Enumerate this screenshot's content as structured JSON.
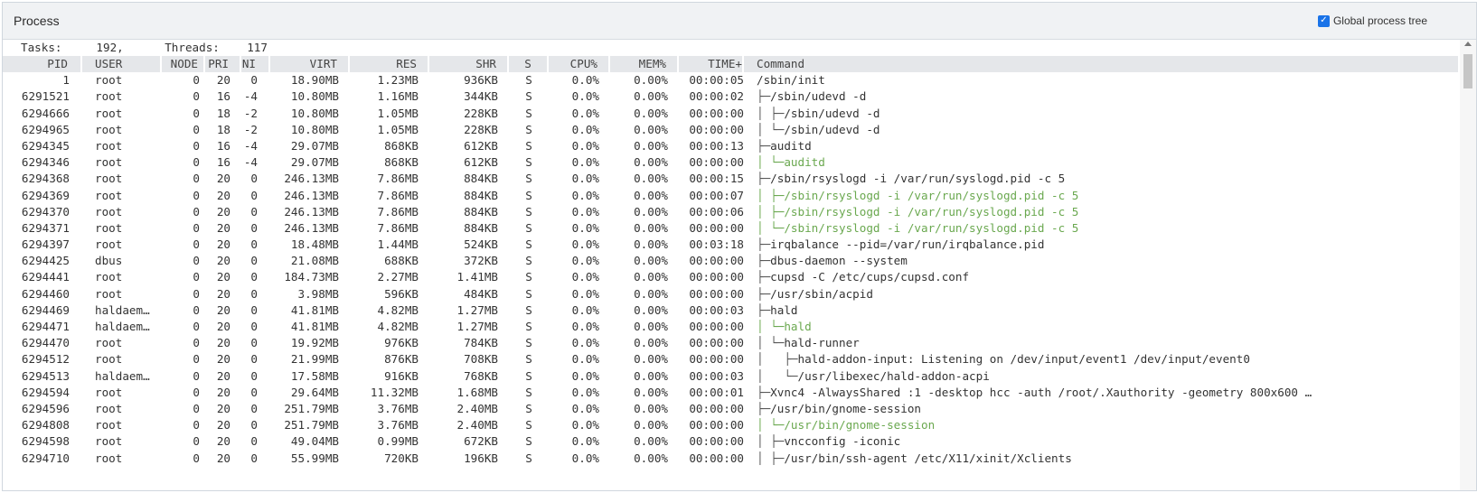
{
  "panel": {
    "title": "Process",
    "tree_toggle_label": "Global process tree",
    "tree_toggle_checked": true
  },
  "stats": {
    "text": "Tasks:     192,      Threads:    117"
  },
  "columns": [
    "PID",
    "USER",
    "NODE",
    "PRI",
    "NI",
    "VIRT",
    "RES",
    "SHR",
    "S",
    "CPU%",
    "MEM%",
    "TIME+",
    "Command"
  ],
  "rows": [
    {
      "pid": "1",
      "user": "root",
      "node": "0",
      "pri": "20",
      "ni": "0",
      "virt": "18.90MB",
      "res": "1.23MB",
      "shr": "936KB",
      "s": "S",
      "cpu": "0.0%",
      "mem": "0.00%",
      "time": "00:00:05",
      "tree": "",
      "cmd": "/sbin/init",
      "thread": false
    },
    {
      "pid": "6291521",
      "user": "root",
      "node": "0",
      "pri": "16",
      "ni": "-4",
      "virt": "10.80MB",
      "res": "1.16MB",
      "shr": "344KB",
      "s": "S",
      "cpu": "0.0%",
      "mem": "0.00%",
      "time": "00:00:02",
      "tree": "├─",
      "cmd": "/sbin/udevd -d",
      "thread": false
    },
    {
      "pid": "6294666",
      "user": "root",
      "node": "0",
      "pri": "18",
      "ni": "-2",
      "virt": "10.80MB",
      "res": "1.05MB",
      "shr": "228KB",
      "s": "S",
      "cpu": "0.0%",
      "mem": "0.00%",
      "time": "00:00:00",
      "tree": "│ ├─",
      "cmd": "/sbin/udevd -d",
      "thread": false
    },
    {
      "pid": "6294965",
      "user": "root",
      "node": "0",
      "pri": "18",
      "ni": "-2",
      "virt": "10.80MB",
      "res": "1.05MB",
      "shr": "228KB",
      "s": "S",
      "cpu": "0.0%",
      "mem": "0.00%",
      "time": "00:00:00",
      "tree": "│ └─",
      "cmd": "/sbin/udevd -d",
      "thread": false
    },
    {
      "pid": "6294345",
      "user": "root",
      "node": "0",
      "pri": "16",
      "ni": "-4",
      "virt": "29.07MB",
      "res": "868KB",
      "shr": "612KB",
      "s": "S",
      "cpu": "0.0%",
      "mem": "0.00%",
      "time": "00:00:13",
      "tree": "├─",
      "cmd": "auditd",
      "thread": false
    },
    {
      "pid": "6294346",
      "user": "root",
      "node": "0",
      "pri": "16",
      "ni": "-4",
      "virt": "29.07MB",
      "res": "868KB",
      "shr": "612KB",
      "s": "S",
      "cpu": "0.0%",
      "mem": "0.00%",
      "time": "00:00:00",
      "tree": "│ └─",
      "cmd": "auditd",
      "thread": true
    },
    {
      "pid": "6294368",
      "user": "root",
      "node": "0",
      "pri": "20",
      "ni": "0",
      "virt": "246.13MB",
      "res": "7.86MB",
      "shr": "884KB",
      "s": "S",
      "cpu": "0.0%",
      "mem": "0.00%",
      "time": "00:00:15",
      "tree": "├─",
      "cmd": "/sbin/rsyslogd -i /var/run/syslogd.pid -c 5",
      "thread": false
    },
    {
      "pid": "6294369",
      "user": "root",
      "node": "0",
      "pri": "20",
      "ni": "0",
      "virt": "246.13MB",
      "res": "7.86MB",
      "shr": "884KB",
      "s": "S",
      "cpu": "0.0%",
      "mem": "0.00%",
      "time": "00:00:07",
      "tree": "│ ├─",
      "cmd": "/sbin/rsyslogd -i /var/run/syslogd.pid -c 5",
      "thread": true
    },
    {
      "pid": "6294370",
      "user": "root",
      "node": "0",
      "pri": "20",
      "ni": "0",
      "virt": "246.13MB",
      "res": "7.86MB",
      "shr": "884KB",
      "s": "S",
      "cpu": "0.0%",
      "mem": "0.00%",
      "time": "00:00:06",
      "tree": "│ ├─",
      "cmd": "/sbin/rsyslogd -i /var/run/syslogd.pid -c 5",
      "thread": true
    },
    {
      "pid": "6294371",
      "user": "root",
      "node": "0",
      "pri": "20",
      "ni": "0",
      "virt": "246.13MB",
      "res": "7.86MB",
      "shr": "884KB",
      "s": "S",
      "cpu": "0.0%",
      "mem": "0.00%",
      "time": "00:00:00",
      "tree": "│ └─",
      "cmd": "/sbin/rsyslogd -i /var/run/syslogd.pid -c 5",
      "thread": true
    },
    {
      "pid": "6294397",
      "user": "root",
      "node": "0",
      "pri": "20",
      "ni": "0",
      "virt": "18.48MB",
      "res": "1.44MB",
      "shr": "524KB",
      "s": "S",
      "cpu": "0.0%",
      "mem": "0.00%",
      "time": "00:03:18",
      "tree": "├─",
      "cmd": "irqbalance --pid=/var/run/irqbalance.pid",
      "thread": false
    },
    {
      "pid": "6294425",
      "user": "dbus",
      "node": "0",
      "pri": "20",
      "ni": "0",
      "virt": "21.08MB",
      "res": "688KB",
      "shr": "372KB",
      "s": "S",
      "cpu": "0.0%",
      "mem": "0.00%",
      "time": "00:00:00",
      "tree": "├─",
      "cmd": "dbus-daemon --system",
      "thread": false
    },
    {
      "pid": "6294441",
      "user": "root",
      "node": "0",
      "pri": "20",
      "ni": "0",
      "virt": "184.73MB",
      "res": "2.27MB",
      "shr": "1.41MB",
      "s": "S",
      "cpu": "0.0%",
      "mem": "0.00%",
      "time": "00:00:00",
      "tree": "├─",
      "cmd": "cupsd -C /etc/cups/cupsd.conf",
      "thread": false
    },
    {
      "pid": "6294460",
      "user": "root",
      "node": "0",
      "pri": "20",
      "ni": "0",
      "virt": "3.98MB",
      "res": "596KB",
      "shr": "484KB",
      "s": "S",
      "cpu": "0.0%",
      "mem": "0.00%",
      "time": "00:00:00",
      "tree": "├─",
      "cmd": "/usr/sbin/acpid",
      "thread": false
    },
    {
      "pid": "6294469",
      "user": "haldaem…",
      "node": "0",
      "pri": "20",
      "ni": "0",
      "virt": "41.81MB",
      "res": "4.82MB",
      "shr": "1.27MB",
      "s": "S",
      "cpu": "0.0%",
      "mem": "0.00%",
      "time": "00:00:03",
      "tree": "├─",
      "cmd": "hald",
      "thread": false
    },
    {
      "pid": "6294471",
      "user": "haldaem…",
      "node": "0",
      "pri": "20",
      "ni": "0",
      "virt": "41.81MB",
      "res": "4.82MB",
      "shr": "1.27MB",
      "s": "S",
      "cpu": "0.0%",
      "mem": "0.00%",
      "time": "00:00:00",
      "tree": "│ └─",
      "cmd": "hald",
      "thread": true
    },
    {
      "pid": "6294470",
      "user": "root",
      "node": "0",
      "pri": "20",
      "ni": "0",
      "virt": "19.92MB",
      "res": "976KB",
      "shr": "784KB",
      "s": "S",
      "cpu": "0.0%",
      "mem": "0.00%",
      "time": "00:00:00",
      "tree": "│ └─",
      "cmd": "hald-runner",
      "thread": false
    },
    {
      "pid": "6294512",
      "user": "root",
      "node": "0",
      "pri": "20",
      "ni": "0",
      "virt": "21.99MB",
      "res": "876KB",
      "shr": "708KB",
      "s": "S",
      "cpu": "0.0%",
      "mem": "0.00%",
      "time": "00:00:00",
      "tree": "│   ├─",
      "cmd": "hald-addon-input: Listening on /dev/input/event1 /dev/input/event0",
      "thread": false
    },
    {
      "pid": "6294513",
      "user": "haldaem…",
      "node": "0",
      "pri": "20",
      "ni": "0",
      "virt": "17.58MB",
      "res": "916KB",
      "shr": "768KB",
      "s": "S",
      "cpu": "0.0%",
      "mem": "0.00%",
      "time": "00:00:03",
      "tree": "│   └─",
      "cmd": "/usr/libexec/hald-addon-acpi",
      "thread": false
    },
    {
      "pid": "6294594",
      "user": "root",
      "node": "0",
      "pri": "20",
      "ni": "0",
      "virt": "29.64MB",
      "res": "11.32MB",
      "shr": "1.68MB",
      "s": "S",
      "cpu": "0.0%",
      "mem": "0.00%",
      "time": "00:00:01",
      "tree": "├─",
      "cmd": "Xvnc4 -AlwaysShared :1 -desktop hcc -auth /root/.Xauthority -geometry 800x600 …",
      "thread": false
    },
    {
      "pid": "6294596",
      "user": "root",
      "node": "0",
      "pri": "20",
      "ni": "0",
      "virt": "251.79MB",
      "res": "3.76MB",
      "shr": "2.40MB",
      "s": "S",
      "cpu": "0.0%",
      "mem": "0.00%",
      "time": "00:00:00",
      "tree": "├─",
      "cmd": "/usr/bin/gnome-session",
      "thread": false
    },
    {
      "pid": "6294808",
      "user": "root",
      "node": "0",
      "pri": "20",
      "ni": "0",
      "virt": "251.79MB",
      "res": "3.76MB",
      "shr": "2.40MB",
      "s": "S",
      "cpu": "0.0%",
      "mem": "0.00%",
      "time": "00:00:00",
      "tree": "│ └─",
      "cmd": "/usr/bin/gnome-session",
      "thread": true
    },
    {
      "pid": "6294598",
      "user": "root",
      "node": "0",
      "pri": "20",
      "ni": "0",
      "virt": "49.04MB",
      "res": "0.99MB",
      "shr": "672KB",
      "s": "S",
      "cpu": "0.0%",
      "mem": "0.00%",
      "time": "00:00:00",
      "tree": "│ ├─",
      "cmd": "vncconfig -iconic",
      "thread": false
    },
    {
      "pid": "6294710",
      "user": "root",
      "node": "0",
      "pri": "20",
      "ni": "0",
      "virt": "55.99MB",
      "res": "720KB",
      "shr": "196KB",
      "s": "S",
      "cpu": "0.0%",
      "mem": "0.00%",
      "time": "00:00:00",
      "tree": "│ ├─",
      "cmd": "/usr/bin/ssh-agent /etc/X11/xinit/Xclients",
      "thread": false
    }
  ]
}
